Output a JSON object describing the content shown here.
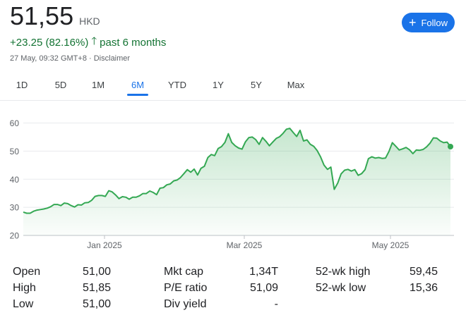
{
  "quote": {
    "price": "51,55",
    "currency": "HKD",
    "change": "+23.25 (82.16%)",
    "change_arrow": "up-arrow-icon",
    "change_period": "past 6 months",
    "timestamp": "27 May, 09:32 GMT+8",
    "separator": "·",
    "disclaimer": "Disclaimer",
    "color_positive": "#137333"
  },
  "follow_button": {
    "icon": "plus-icon",
    "label": "Follow",
    "color": "#1a73e8"
  },
  "tabs": [
    {
      "label": "1D",
      "active": false
    },
    {
      "label": "5D",
      "active": false
    },
    {
      "label": "1M",
      "active": false
    },
    {
      "label": "6M",
      "active": true
    },
    {
      "label": "YTD",
      "active": false
    },
    {
      "label": "1Y",
      "active": false
    },
    {
      "label": "5Y",
      "active": false
    },
    {
      "label": "Max",
      "active": false
    }
  ],
  "chart_data": {
    "type": "area",
    "line_color": "#34a853",
    "ylim": [
      20,
      60
    ],
    "yticks": [
      20,
      30,
      40,
      50,
      60
    ],
    "xtick_labels": [
      "Jan 2025",
      "Mar 2025",
      "May 2025"
    ],
    "grid": true,
    "values": [
      28.3,
      27.9,
      27.9,
      28.6,
      29.0,
      29.2,
      29.4,
      29.7,
      30.2,
      31.0,
      31.0,
      30.6,
      31.5,
      31.3,
      30.6,
      30.1,
      30.9,
      30.8,
      31.6,
      31.7,
      32.5,
      33.9,
      34.2,
      34.2,
      33.9,
      35.9,
      35.5,
      34.4,
      33.1,
      33.8,
      33.6,
      32.9,
      33.6,
      33.6,
      34.1,
      34.9,
      34.9,
      35.8,
      35.3,
      34.5,
      36.8,
      37.0,
      38.0,
      38.3,
      39.4,
      39.7,
      40.6,
      42.0,
      43.4,
      42.5,
      43.6,
      41.5,
      43.9,
      44.6,
      47.7,
      48.8,
      48.4,
      50.9,
      51.6,
      53.1,
      56.2,
      53.1,
      51.9,
      51.1,
      50.7,
      53.3,
      54.8,
      55.0,
      54.1,
      52.4,
      54.8,
      53.5,
      51.9,
      53.2,
      54.5,
      55.1,
      56.3,
      57.8,
      58.1,
      56.6,
      55.2,
      57.4,
      53.6,
      54.0,
      52.4,
      51.7,
      50.2,
      47.9,
      45.0,
      43.5,
      44.3,
      36.4,
      38.6,
      41.9,
      43.2,
      43.5,
      42.9,
      43.4,
      41.4,
      42.0,
      43.4,
      47.3,
      48.0,
      47.5,
      47.7,
      47.4,
      47.5,
      49.9,
      53.0,
      51.7,
      50.4,
      50.8,
      51.3,
      50.5,
      49.1,
      50.4,
      50.3,
      50.6,
      51.5,
      52.8,
      54.7,
      54.6,
      53.6,
      53.0,
      53.2,
      51.6
    ]
  },
  "stats": {
    "col1": [
      {
        "label": "Open",
        "value": "51,00"
      },
      {
        "label": "High",
        "value": "51,85"
      },
      {
        "label": "Low",
        "value": "51,00"
      }
    ],
    "col2": [
      {
        "label": "Mkt cap",
        "value": "1,34T"
      },
      {
        "label": "P/E ratio",
        "value": "51,09"
      },
      {
        "label": "Div yield",
        "value": "-"
      }
    ],
    "col3": [
      {
        "label": "52-wk high",
        "value": "59,45"
      },
      {
        "label": "52-wk low",
        "value": "15,36"
      }
    ]
  }
}
